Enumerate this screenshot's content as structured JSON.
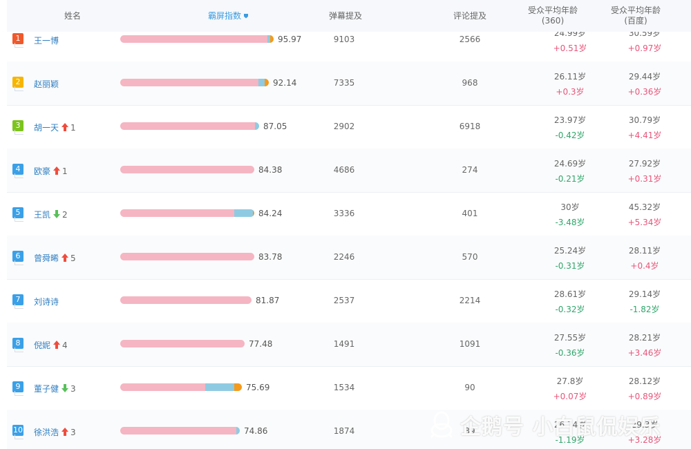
{
  "header": {
    "name": "姓名",
    "index": "霸屏指数",
    "danmu": "弹幕提及",
    "comment": "评论提及",
    "age360_line1": "受众平均年龄",
    "age360_line2": "(360)",
    "agebd_line1": "受众平均年龄",
    "agebd_line2": "(百度)"
  },
  "colors": {
    "rank1": "#f0592c",
    "rank2": "#f7b500",
    "rank3": "#7cc41d",
    "rank_other": "#3aa0e8",
    "name": "#2f7fc2",
    "positive": "#e8557a",
    "negative": "#2fa66a"
  },
  "rows": [
    {
      "rank": "1",
      "name": "王一博",
      "trend": "",
      "trend_val": "",
      "score": "95.97",
      "danmu": "9103",
      "comment": "2566",
      "age360": "24.99岁",
      "age360_delta": "+0.51岁",
      "agebd": "30.59岁",
      "agebd_delta": "+0.97岁",
      "bar_total": 0.95,
      "bar_pink": 0.96,
      "bar_blue": 0.02,
      "bar_orange": 0.0
    },
    {
      "rank": "2",
      "name": "赵丽颖",
      "trend": "",
      "trend_val": "",
      "score": "92.14",
      "danmu": "7335",
      "comment": "968",
      "age360": "26.11岁",
      "age360_delta": "+0.3岁",
      "agebd": "29.44岁",
      "agebd_delta": "+0.36岁",
      "bar_total": 0.92,
      "bar_pink": 0.93,
      "bar_blue": 0.04,
      "bar_orange": 0.03
    },
    {
      "rank": "3",
      "name": "胡一天",
      "trend": "up",
      "trend_val": "1",
      "score": "87.05",
      "danmu": "2902",
      "comment": "6918",
      "age360": "23.97岁",
      "age360_delta": "-0.42岁",
      "agebd": "30.79岁",
      "agebd_delta": "+4.41岁",
      "bar_total": 0.86,
      "bar_pink": 0.97,
      "bar_blue": 0.03,
      "bar_orange": 0.0
    },
    {
      "rank": "4",
      "name": "欧豪",
      "trend": "up",
      "trend_val": "1",
      "score": "84.38",
      "danmu": "4686",
      "comment": "274",
      "age360": "24.69岁",
      "age360_delta": "-0.21岁",
      "agebd": "27.92岁",
      "agebd_delta": "+0.31岁",
      "bar_total": 0.83,
      "bar_pink": 1.0,
      "bar_blue": 0.0,
      "bar_orange": 0.0
    },
    {
      "rank": "5",
      "name": "王凯",
      "trend": "down",
      "trend_val": "2",
      "score": "84.24",
      "danmu": "3336",
      "comment": "401",
      "age360": "30岁",
      "age360_delta": "-3.48岁",
      "agebd": "45.32岁",
      "agebd_delta": "+5.34岁",
      "bar_total": 0.83,
      "bar_pink": 0.85,
      "bar_blue": 0.14,
      "bar_orange": 0.01
    },
    {
      "rank": "6",
      "name": "曾舜晞",
      "trend": "up",
      "trend_val": "5",
      "score": "83.78",
      "danmu": "2246",
      "comment": "570",
      "age360": "25.24岁",
      "age360_delta": "-0.31岁",
      "agebd": "28.11岁",
      "agebd_delta": "+0.4岁",
      "bar_total": 0.83,
      "bar_pink": 1.0,
      "bar_blue": 0.0,
      "bar_orange": 0.0
    },
    {
      "rank": "7",
      "name": "刘诗诗",
      "trend": "",
      "trend_val": "",
      "score": "81.87",
      "danmu": "2537",
      "comment": "2214",
      "age360": "28.61岁",
      "age360_delta": "-0.32岁",
      "agebd": "29.14岁",
      "agebd_delta": "-1.82岁",
      "bar_total": 0.81,
      "bar_pink": 1.0,
      "bar_blue": 0.0,
      "bar_orange": 0.0
    },
    {
      "rank": "8",
      "name": "倪妮",
      "trend": "up",
      "trend_val": "4",
      "score": "77.48",
      "danmu": "1491",
      "comment": "1091",
      "age360": "27.55岁",
      "age360_delta": "-0.36岁",
      "agebd": "28.21岁",
      "agebd_delta": "+3.46岁",
      "bar_total": 0.77,
      "bar_pink": 1.0,
      "bar_blue": 0.0,
      "bar_orange": 0.0
    },
    {
      "rank": "9",
      "name": "董子健",
      "trend": "down",
      "trend_val": "3",
      "score": "75.69",
      "danmu": "1534",
      "comment": "90",
      "age360": "27.8岁",
      "age360_delta": "+0.07岁",
      "agebd": "28.12岁",
      "agebd_delta": "+0.89岁",
      "bar_total": 0.75,
      "bar_pink": 0.7,
      "bar_blue": 0.24,
      "bar_orange": 0.06
    },
    {
      "rank": "10",
      "name": "徐洪浩",
      "trend": "up",
      "trend_val": "3",
      "score": "74.86",
      "danmu": "1874",
      "comment": "39",
      "age360": "26.74岁",
      "age360_delta": "-1.19岁",
      "agebd": "29.3岁",
      "agebd_delta": "+3.28岁",
      "bar_total": 0.74,
      "bar_pink": 0.97,
      "bar_blue": 0.03,
      "bar_orange": 0.0
    }
  ],
  "watermark": {
    "text": "企鹅号 小白鼠侃娱乐"
  }
}
